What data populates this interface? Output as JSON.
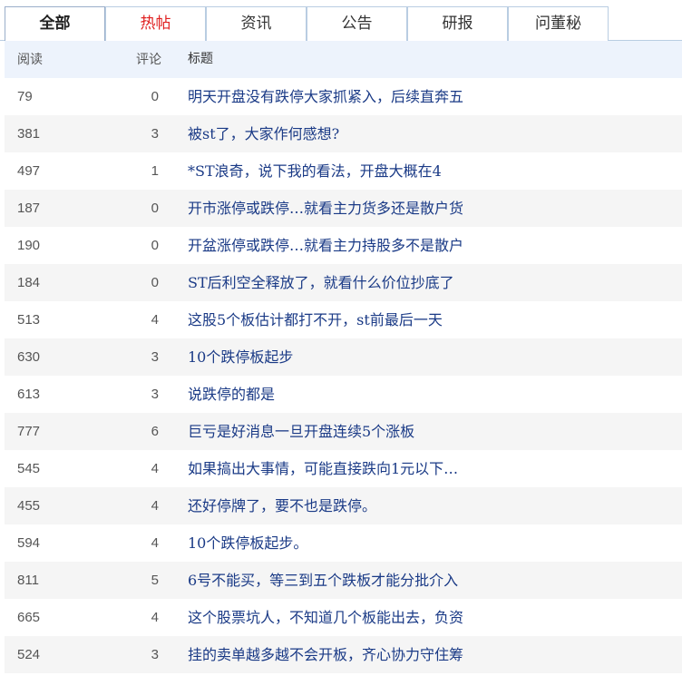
{
  "tabs": [
    {
      "label": "全部",
      "active": true
    },
    {
      "label": "热帖",
      "active": false,
      "color": "#e02020"
    },
    {
      "label": "资讯",
      "active": false
    },
    {
      "label": "公告",
      "active": false
    },
    {
      "label": "研报",
      "active": false
    },
    {
      "label": "问董秘",
      "active": false
    }
  ],
  "columns": {
    "read": "阅读",
    "comments": "评论",
    "title": "标题"
  },
  "rows": [
    {
      "read": "79",
      "comments": "0",
      "title": "明天开盘没有跌停大家抓紧入，后续直奔五"
    },
    {
      "read": "381",
      "comments": "3",
      "title": "被st了，大家作何感想?"
    },
    {
      "read": "497",
      "comments": "1",
      "title": "*ST浪奇，说下我的看法，开盘大概在4"
    },
    {
      "read": "187",
      "comments": "0",
      "title": "开市涨停或跌停…就看主力货多还是散户货"
    },
    {
      "read": "190",
      "comments": "0",
      "title": "开盆涨停或跌停…就看主力持股多不是散户"
    },
    {
      "read": "184",
      "comments": "0",
      "title": "ST后利空全释放了，就看什么价位抄底了"
    },
    {
      "read": "513",
      "comments": "4",
      "title": "这股5个板估计都打不开，st前最后一天"
    },
    {
      "read": "630",
      "comments": "3",
      "title": "10个跌停板起步"
    },
    {
      "read": "613",
      "comments": "3",
      "title": "说跌停的都是"
    },
    {
      "read": "777",
      "comments": "6",
      "title": "巨亏是好消息一旦开盘连续5个涨板"
    },
    {
      "read": "545",
      "comments": "4",
      "title": "如果搞出大事情，可能直接跌向1元以下…"
    },
    {
      "read": "455",
      "comments": "4",
      "title": "还好停牌了，要不也是跌停。"
    },
    {
      "read": "594",
      "comments": "4",
      "title": "10个跌停板起步。"
    },
    {
      "read": "811",
      "comments": "5",
      "title": "6号不能买，等三到五个跌板才能分批介入"
    },
    {
      "read": "665",
      "comments": "4",
      "title": "这个股票坑人，不知道几个板能出去，负资"
    },
    {
      "read": "524",
      "comments": "3",
      "title": "挂的卖单越多越不会开板，齐心协力守住筹"
    }
  ]
}
